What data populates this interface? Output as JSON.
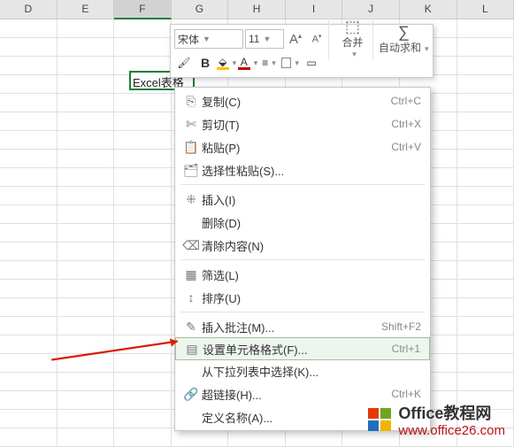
{
  "columns": [
    "D",
    "E",
    "F",
    "G",
    "H",
    "I",
    "J",
    "K",
    "L"
  ],
  "active_col": "F",
  "active_cell_value": "Excel表格",
  "toolbar": {
    "font_name": "宋体",
    "font_size": "11",
    "increase_font": "A",
    "decrease_font": "A",
    "merge_label": "合并",
    "autosum_label": "自动求和",
    "bold": "B",
    "fill_color": "#ffc000",
    "font_color": "#c00000"
  },
  "menu": [
    {
      "icon": "⎘",
      "label": "复制(C)",
      "shortcut": "Ctrl+C"
    },
    {
      "icon": "✄",
      "label": "剪切(T)",
      "shortcut": "Ctrl+X"
    },
    {
      "icon": "📋",
      "label": "粘贴(P)",
      "shortcut": "Ctrl+V"
    },
    {
      "icon": "🗂",
      "label": "选择性粘贴(S)...",
      "shortcut": ""
    },
    {
      "sep": true
    },
    {
      "icon": "⁜",
      "label": "插入(I)",
      "shortcut": ""
    },
    {
      "icon": "",
      "label": "删除(D)",
      "shortcut": ""
    },
    {
      "icon": "⌫",
      "label": "清除内容(N)",
      "shortcut": ""
    },
    {
      "sep": true
    },
    {
      "icon": "▦",
      "label": "筛选(L)",
      "shortcut": ""
    },
    {
      "icon": "↕",
      "label": "排序(U)",
      "shortcut": ""
    },
    {
      "sep": true
    },
    {
      "icon": "✎",
      "label": "插入批注(M)...",
      "shortcut": "Shift+F2"
    },
    {
      "icon": "▤",
      "label": "设置单元格格式(F)...",
      "shortcut": "Ctrl+1",
      "highlight": true
    },
    {
      "icon": "",
      "label": "从下拉列表中选择(K)...",
      "shortcut": ""
    },
    {
      "icon": "🔗",
      "label": "超链接(H)...",
      "shortcut": "Ctrl+K"
    },
    {
      "icon": "",
      "label": "定义名称(A)...",
      "shortcut": ""
    }
  ],
  "watermark": {
    "main": "Office教程网",
    "sub": "www.office26.com"
  }
}
